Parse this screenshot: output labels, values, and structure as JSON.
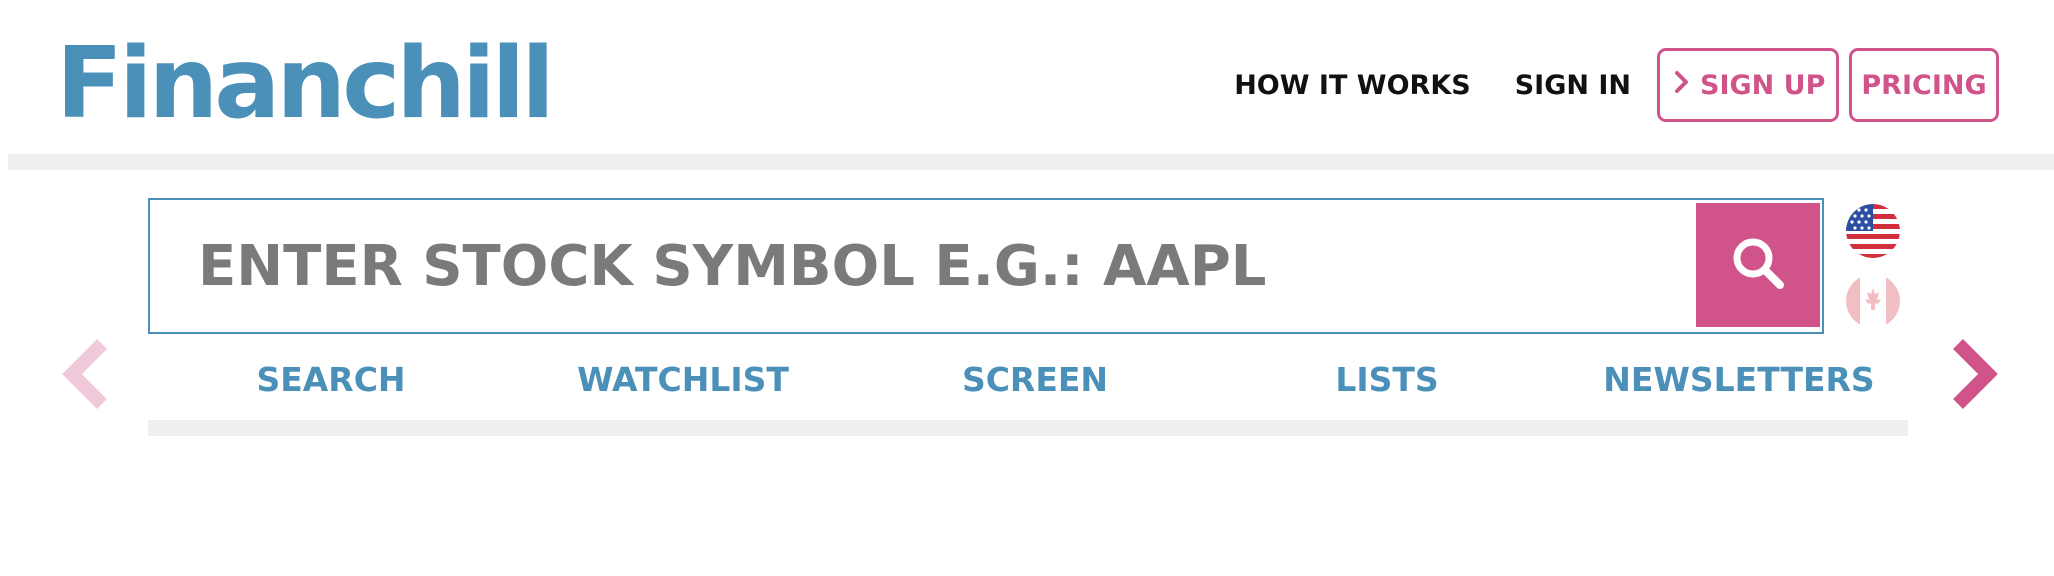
{
  "brand": {
    "logo_text": "Financhill",
    "color": "#4a90b8",
    "accent": "#d0548a"
  },
  "header": {
    "nav": {
      "how_it_works": "HOW IT WORKS",
      "sign_in": "SIGN IN",
      "sign_up": "SIGN UP",
      "sign_up_icon": "chevron-right-icon",
      "pricing": "PRICING"
    }
  },
  "search": {
    "placeholder": "ENTER STOCK SYMBOL E.G.: AAPL",
    "button_icon": "search-icon"
  },
  "markets": [
    {
      "name": "us-flag-icon",
      "active": true
    },
    {
      "name": "canada-flag-icon",
      "active": false
    }
  ],
  "tabs": [
    {
      "label": "SEARCH"
    },
    {
      "label": "WATCHLIST"
    },
    {
      "label": "SCREEN"
    },
    {
      "label": "LISTS"
    },
    {
      "label": "NEWSLETTERS"
    }
  ],
  "carousel": {
    "prev_icon": "chevron-left-icon",
    "next_icon": "chevron-right-icon"
  }
}
